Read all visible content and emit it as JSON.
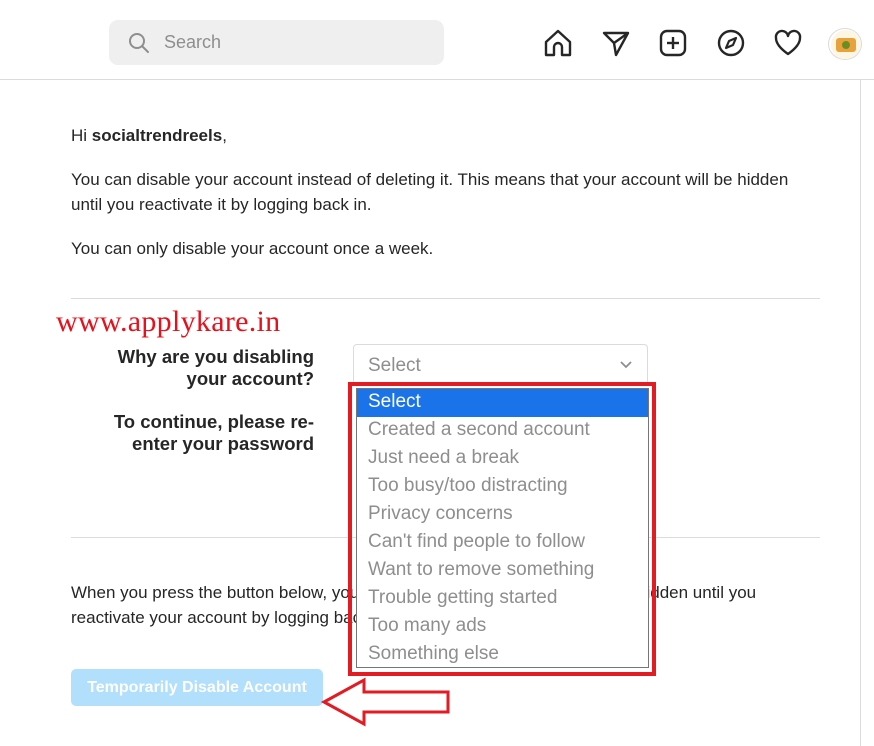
{
  "header": {
    "search_placeholder": "Search",
    "nav_icons": [
      "home-icon",
      "direct-messages-icon",
      "new-post-icon",
      "explore-icon",
      "activity-heart-icon",
      "profile-avatar"
    ]
  },
  "content": {
    "greeting_prefix": "Hi ",
    "username": "socialtrendreels",
    "greeting_suffix": ",",
    "disable_info": "You can disable your account instead of deleting it. This means that your account will be hidden until you reactivate it by logging back in.",
    "once_week": "You can only disable your account once a week.",
    "reason_label": "Why are you disabling your account?",
    "password_label": "To continue, please re-enter your password",
    "bottom_text": "When you press the button below, your photos, comments and likes will be hidden until you reactivate your account by logging back in.",
    "button_label": "Temporarily Disable Account"
  },
  "reason_select": {
    "value": "Select",
    "options": [
      "Select",
      "Created a second account",
      "Just need a break",
      "Too busy/too distracting",
      "Privacy concerns",
      "Can't find people to follow",
      "Want to remove something",
      "Trouble getting started",
      "Too many ads",
      "Something else"
    ],
    "selected_index": 0
  },
  "overlay": {
    "watermark": "www.applykare.in",
    "highlight_color": "#e31b23"
  },
  "colors": {
    "accent": "#1a73e8",
    "button_disabled": "#b2dffc",
    "text": "#262626",
    "muted": "#8e8e8e"
  }
}
